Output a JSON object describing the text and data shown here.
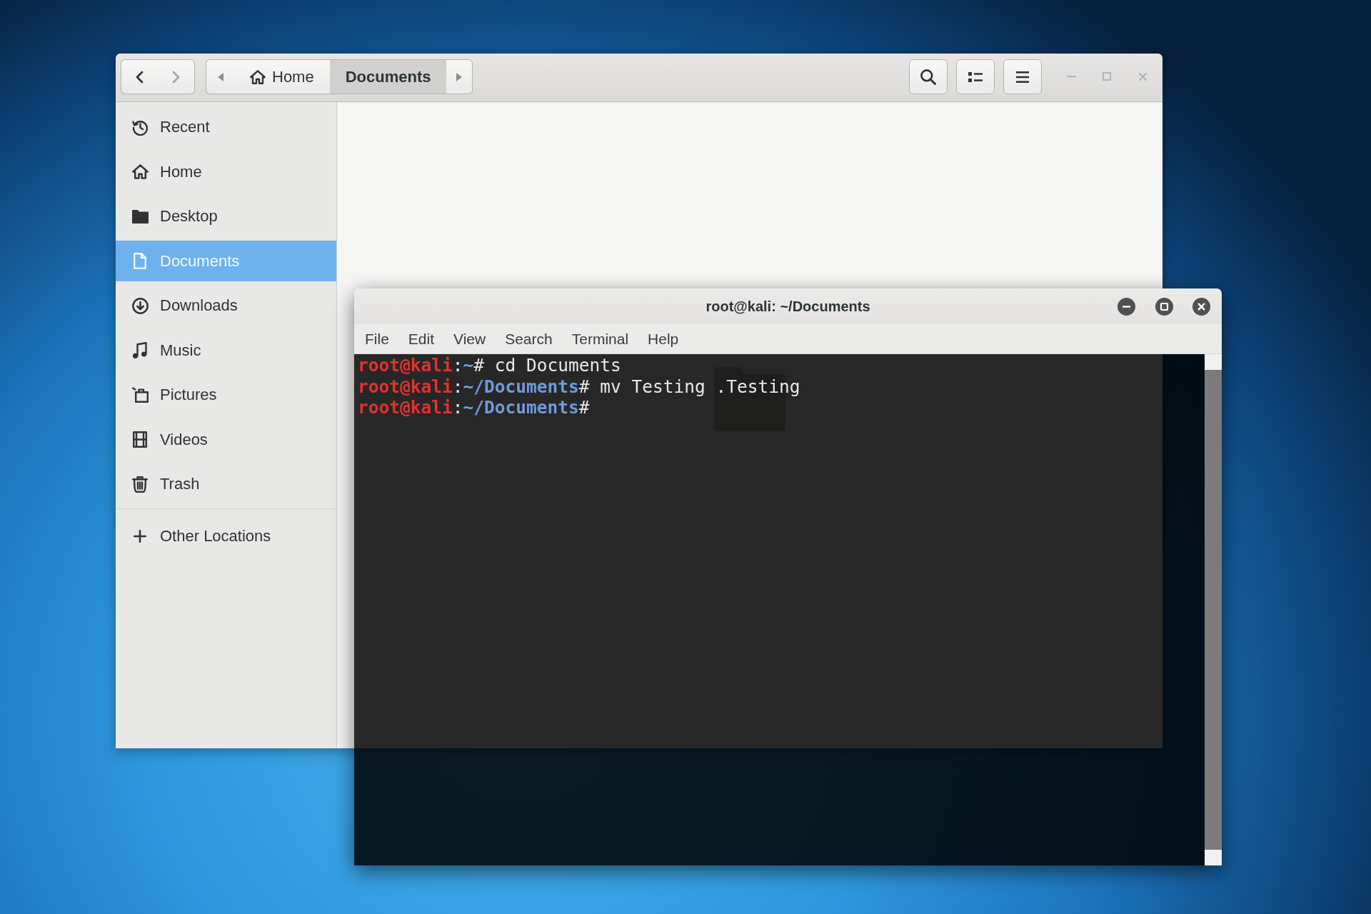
{
  "file_manager": {
    "focused": false,
    "navigation": {
      "back_disabled": false,
      "forward_disabled": true
    },
    "path_bar": [
      {
        "kind": "home",
        "label": "Home",
        "selected": false
      },
      {
        "kind": "folder",
        "label": "Documents",
        "selected": true
      }
    ],
    "sidebar": {
      "places": [
        {
          "kind": "recent",
          "label": "Recent",
          "selected": false
        },
        {
          "kind": "home",
          "label": "Home",
          "selected": false
        },
        {
          "kind": "desktop",
          "label": "Desktop",
          "selected": false
        },
        {
          "kind": "documents",
          "label": "Documents",
          "selected": true
        },
        {
          "kind": "downloads",
          "label": "Downloads",
          "selected": false
        },
        {
          "kind": "music",
          "label": "Music",
          "selected": false
        },
        {
          "kind": "pictures",
          "label": "Pictures",
          "selected": false
        },
        {
          "kind": "videos",
          "label": "Videos",
          "selected": false
        },
        {
          "kind": "trash",
          "label": "Trash",
          "selected": false
        }
      ],
      "other_places": [
        {
          "kind": "other",
          "label": "Other Locations",
          "selected": false
        }
      ]
    }
  },
  "terminal": {
    "focused": true,
    "title": "root@kali: ~/Documents",
    "menu": [
      "File",
      "Edit",
      "View",
      "Search",
      "Terminal",
      "Help"
    ],
    "lines": [
      {
        "segments": [
          {
            "kind": "user",
            "text": "root@kali"
          },
          {
            "kind": "text",
            "text": ":"
          },
          {
            "kind": "path",
            "text": "~"
          },
          {
            "kind": "text",
            "text": "# cd Documents"
          }
        ]
      },
      {
        "segments": [
          {
            "kind": "user",
            "text": "root@kali"
          },
          {
            "kind": "text",
            "text": ":"
          },
          {
            "kind": "path",
            "text": "~/Documents"
          },
          {
            "kind": "text",
            "text": "# mv Testing .Testing"
          }
        ]
      },
      {
        "segments": [
          {
            "kind": "user",
            "text": "root@kali"
          },
          {
            "kind": "text",
            "text": ":"
          },
          {
            "kind": "path",
            "text": "~/Documents"
          },
          {
            "kind": "text",
            "text": "#"
          }
        ]
      }
    ]
  }
}
